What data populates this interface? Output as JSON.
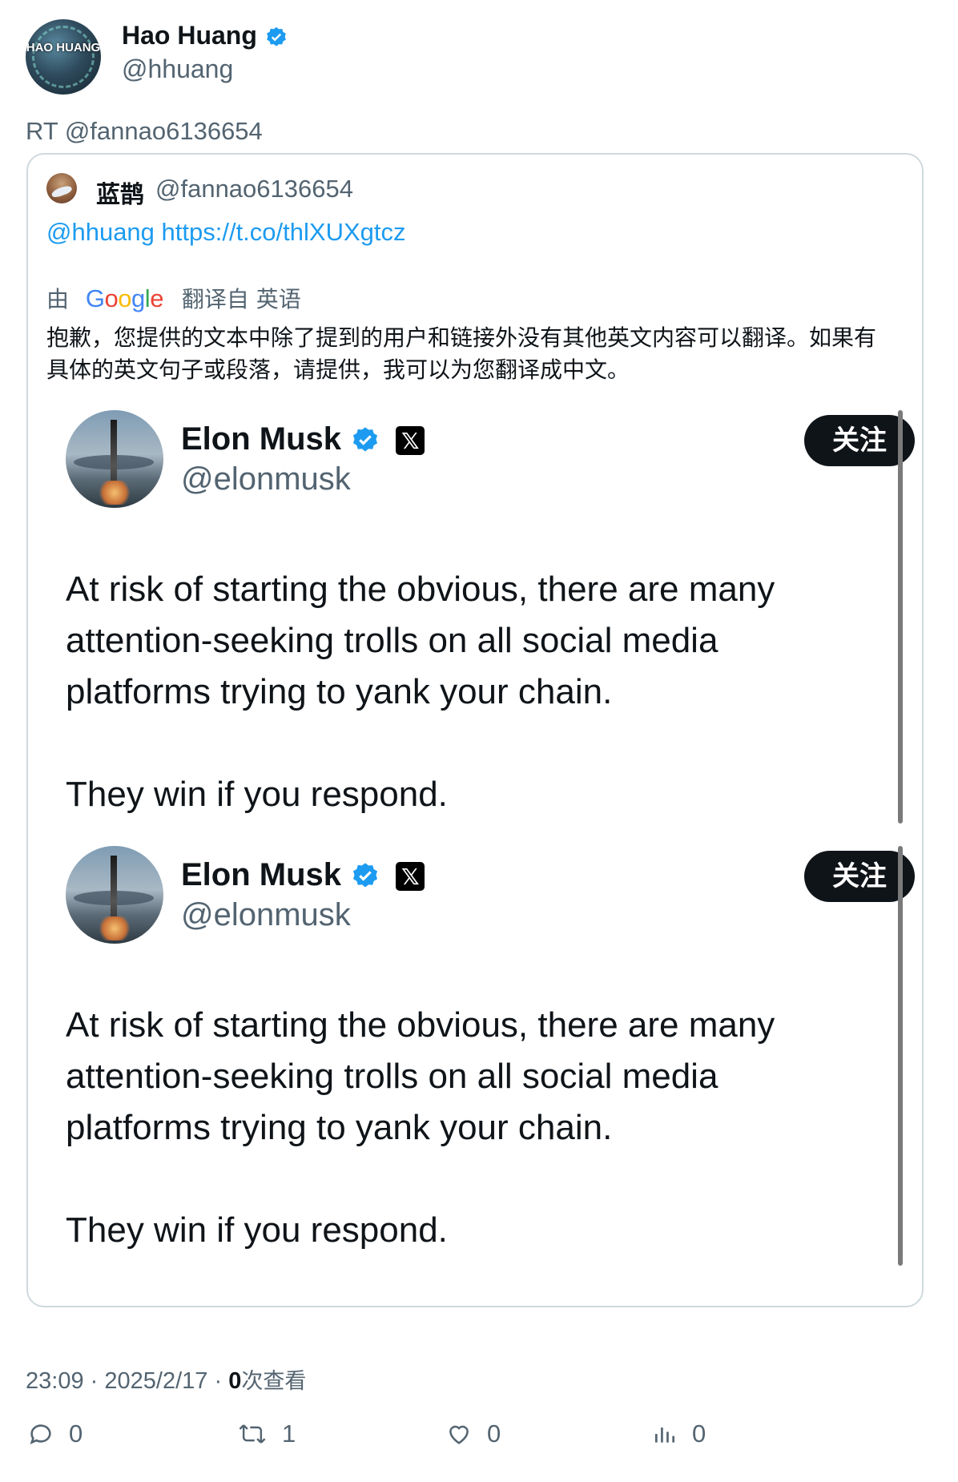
{
  "author": {
    "name": "Hao Huang",
    "handle": "@hhuang",
    "avatar_text": "HAO HUANG"
  },
  "retweet_line": "RT @fannao6136654",
  "quote": {
    "name": "蓝鹊",
    "handle": "@fannao6136654",
    "link_text": "@hhuang https://t.co/thlXUXgtcz",
    "translated_by_prefix": "由",
    "translated_by_brand": "Google",
    "translated_from": "翻译自 英语",
    "translation": "抱歉，您提供的文本中除了提到的用户和链接外没有其他英文内容可以翻译。如果有具体的英文句子或段落，请提供，我可以为您翻译成中文。"
  },
  "embeds": [
    {
      "name": "Elon Musk",
      "handle": "@elonmusk",
      "follow_label": "关注",
      "paragraph_1": "At risk of starting the obvious, there are many attention-seeking trolls on all social media platforms trying to yank your chain.",
      "paragraph_2": "They win if you respond."
    },
    {
      "name": "Elon Musk",
      "handle": "@elonmusk",
      "follow_label": "关注",
      "paragraph_1": "At risk of starting the obvious, there are many attention-seeking trolls on all social media platforms trying to yank your chain.",
      "paragraph_2": "They win if you respond."
    }
  ],
  "meta": {
    "time": "23:09",
    "sep1": "·",
    "date": "2025/2/17",
    "sep2": "·",
    "views_count": "0",
    "views_label": "次查看"
  },
  "actions": {
    "reply_count": "0",
    "retweet_count": "1",
    "like_count": "0",
    "views_count": "0"
  },
  "icons": [
    "verified-badge-icon",
    "x-logo-icon",
    "reply-icon",
    "retweet-icon",
    "like-icon",
    "views-icon"
  ],
  "colors": {
    "link": "#1d9bf0",
    "verified": "#1d9bf0",
    "secondary_text": "#536471",
    "follow_button": "#0f1419",
    "card_border": "#cfd9de"
  }
}
